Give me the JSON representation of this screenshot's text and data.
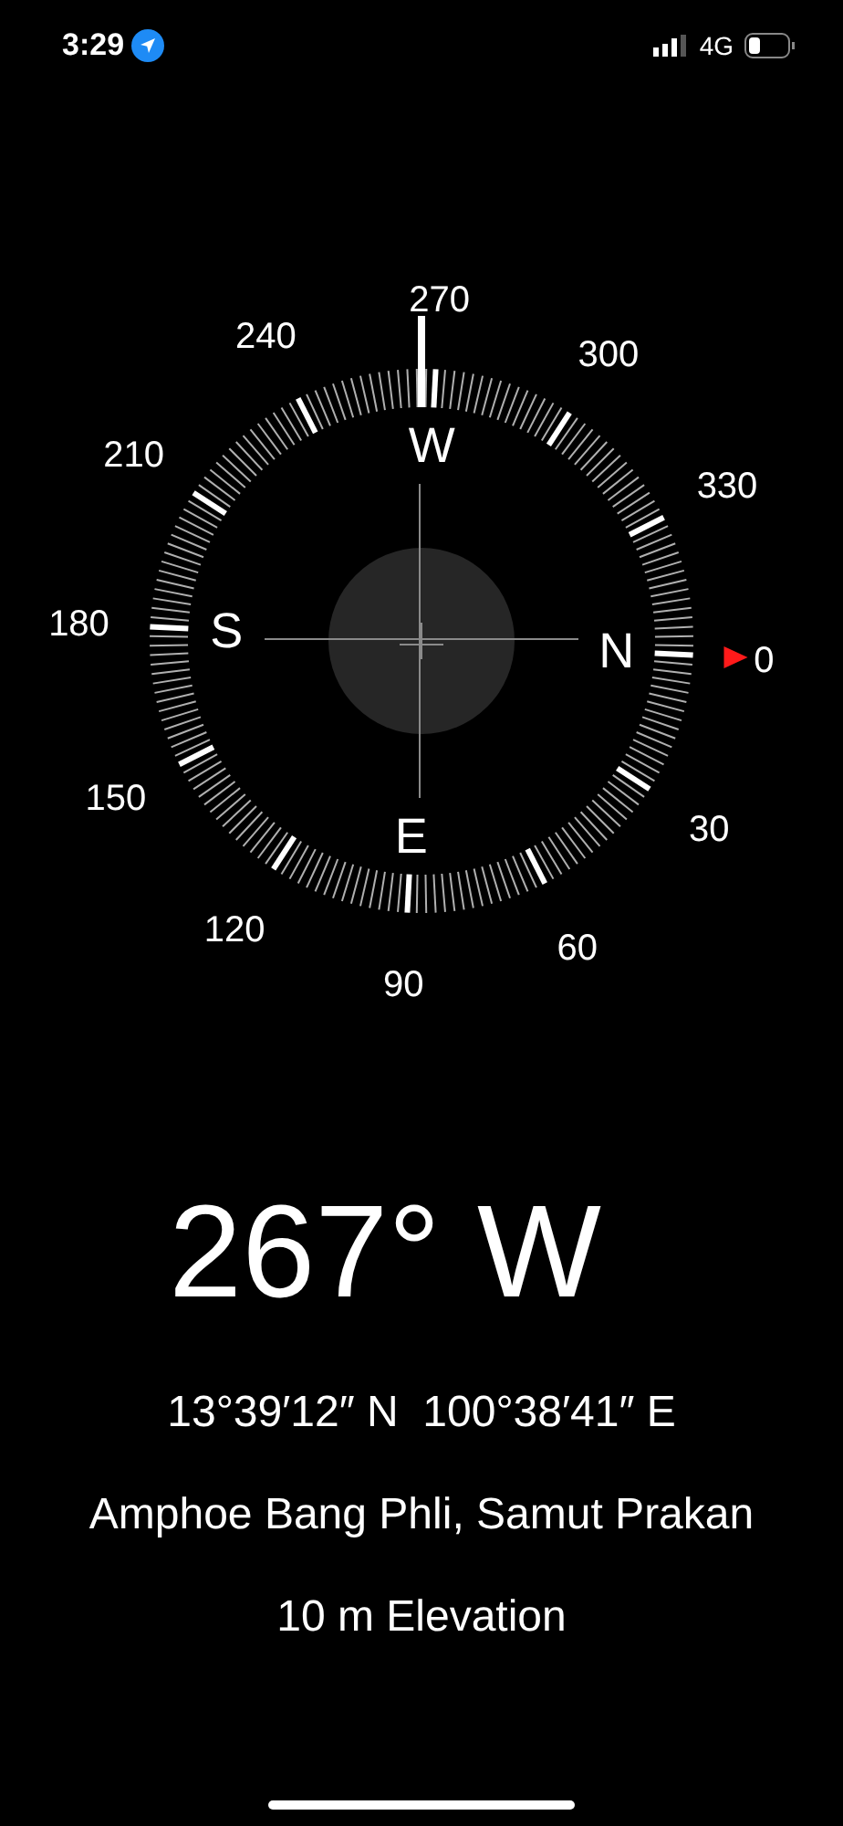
{
  "status_bar": {
    "time": "3:29",
    "network": "4G"
  },
  "compass": {
    "cardinals": [
      "N",
      "E",
      "S",
      "W"
    ],
    "degree_labels": [
      "0",
      "30",
      "60",
      "90",
      "120",
      "150",
      "180",
      "210",
      "240",
      "270",
      "300",
      "330"
    ]
  },
  "readout": {
    "heading": "267° W",
    "coordinates": "13°39′12″ N  100°38′41″ E",
    "place": "Amphoe Bang Phli, Samut Prakan",
    "elevation": "10 m Elevation"
  }
}
